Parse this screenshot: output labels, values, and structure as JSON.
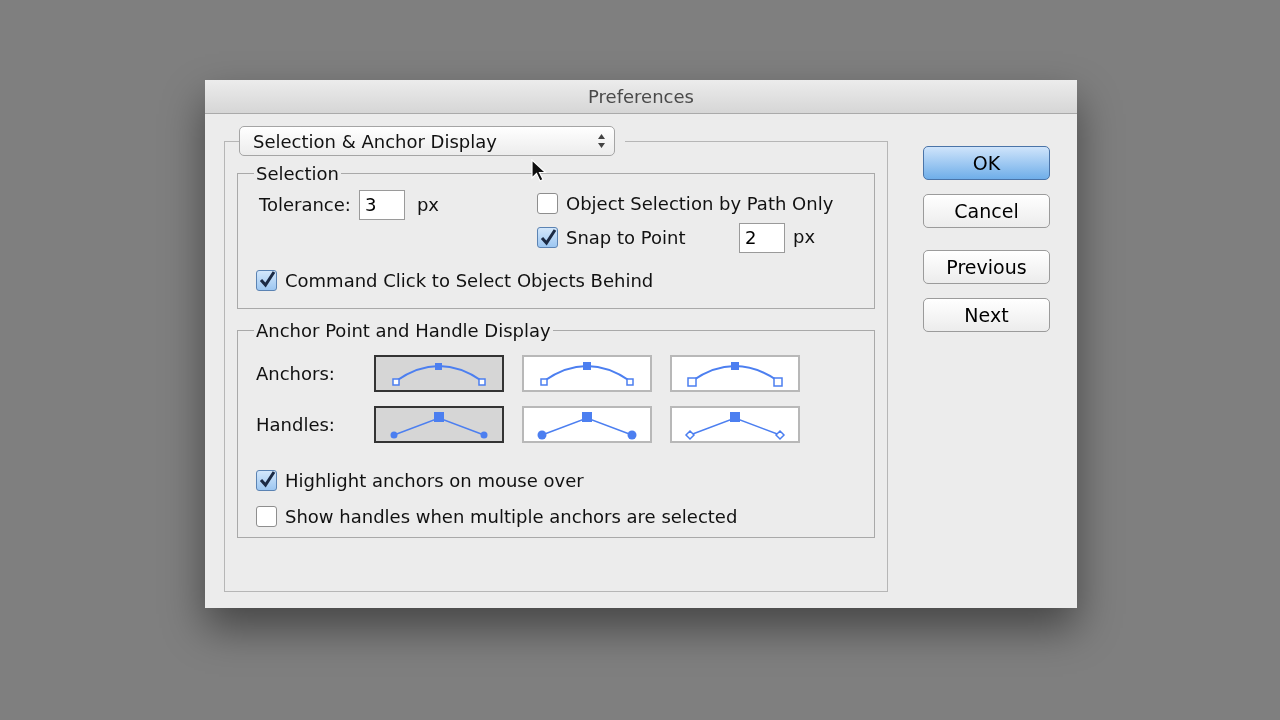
{
  "window": {
    "title": "Preferences"
  },
  "panel_select": {
    "value": "Selection & Anchor Display"
  },
  "selection": {
    "title": "Selection",
    "tolerance": {
      "label": "Tolerance:",
      "value": "3",
      "unit": "px"
    },
    "object_selection_by_path": {
      "label": "Object Selection by Path Only",
      "checked": false
    },
    "snap_to_point": {
      "label": "Snap to Point",
      "checked": true,
      "value": "2",
      "unit": "px"
    },
    "command_click": {
      "label": "Command Click to Select Objects Behind",
      "checked": true
    }
  },
  "anchor_display": {
    "title": "Anchor Point and Handle Display",
    "rows": [
      {
        "label": "Anchors:",
        "options": [
          {
            "kind": "small-square-ends",
            "selected": true
          },
          {
            "kind": "filled-center",
            "selected": false
          },
          {
            "kind": "large-square-ends",
            "selected": false
          }
        ]
      },
      {
        "label": "Handles:",
        "options": [
          {
            "kind": "small-dots",
            "selected": true
          },
          {
            "kind": "large-dots",
            "selected": false
          },
          {
            "kind": "diamonds",
            "selected": false
          }
        ]
      }
    ],
    "options": [
      {
        "label": "Highlight anchors on mouse over",
        "checked": true
      },
      {
        "label": "Show handles when multiple anchors are selected",
        "checked": false
      }
    ]
  },
  "buttons": [
    {
      "label": "OK",
      "default": true
    },
    {
      "label": "Cancel",
      "default": false
    },
    {
      "label": "Previous",
      "default": false
    },
    {
      "label": "Next",
      "default": false
    }
  ]
}
